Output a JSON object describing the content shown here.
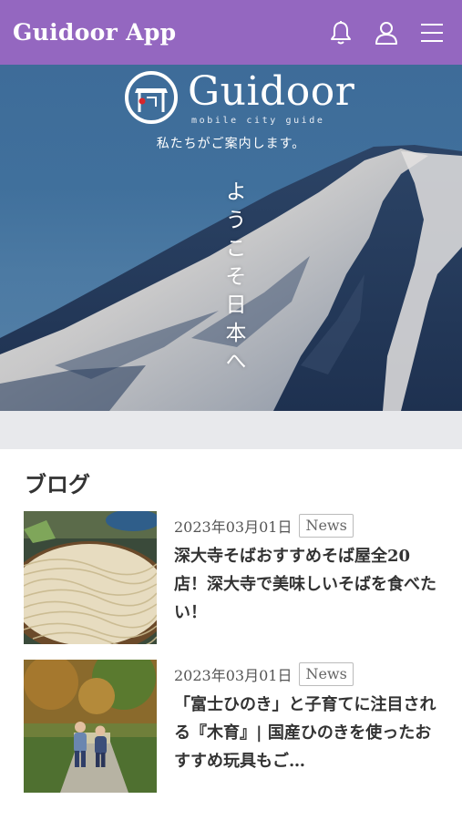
{
  "header": {
    "title": "Guidoor App",
    "icons": [
      "bell-icon",
      "user-icon",
      "menu-icon"
    ],
    "color": "#9467c0"
  },
  "hero": {
    "logo_text": "Guidoor",
    "logo_subtext": "mobile city guide",
    "tagline": "私たちがご案内します。",
    "vertical_text": "ようこそ日本へ"
  },
  "blog": {
    "heading": "ブログ",
    "posts": [
      {
        "date": "2023年03月01日",
        "tag": "News",
        "title": "深大寺そばおすすめそば屋全20店！深大寺で美味しいそばを食べたい！"
      },
      {
        "date": "2023年03月01日",
        "tag": "News",
        "title": "「富士ひのき」と子育てに注目される『木育』| 国産ひのきを使ったおすすめ玩具もご…"
      }
    ]
  }
}
